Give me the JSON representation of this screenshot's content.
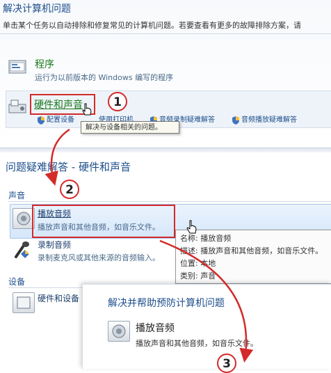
{
  "top": {
    "title": "解决计算机问题",
    "description": "单击某个任务以自动排除和修复常见的计算机问题。若要查看有更多的故障排除方案，请"
  },
  "categories": [
    {
      "name": "程序",
      "desc": "运行为以前版本的 Windows 编写的程序"
    },
    {
      "name": "硬件和声音",
      "links": [
        "配置设备",
        "使用打印机",
        "音频录制疑难解答",
        "音频播放疑难解答"
      ]
    }
  ],
  "tooltip1": "解决与设备相关的问题。",
  "troubleshoot": {
    "title": "问题疑难解答 - 硬件和声音",
    "sections": [
      {
        "label": "声音",
        "items": [
          {
            "title": "播放音频",
            "desc": "播放声音和其他音频，如音乐文件。"
          },
          {
            "title": "录制音频",
            "desc": "录制麦克风或其他来源的音频输入。"
          }
        ]
      },
      {
        "label": "设备",
        "items": [
          {
            "title": "硬件和设备",
            "desc": ""
          }
        ]
      }
    ]
  },
  "tooltip2": {
    "name": "名称: 播放音频",
    "desc": "描述: 播放声音和其他音频，如音乐文件。",
    "location": "位置: 本地",
    "category": "类别: 声音"
  },
  "popup": {
    "title": "解决并帮助预防计算机问题",
    "item_title": "播放音频",
    "item_desc": "播放声音和其他音频，如音乐文件。"
  },
  "steps": [
    "1",
    "2",
    "3"
  ],
  "colors": {
    "accent_red": "#d42a2a",
    "link_blue": "#1e4f8c",
    "link_green": "#1a7a1a"
  }
}
